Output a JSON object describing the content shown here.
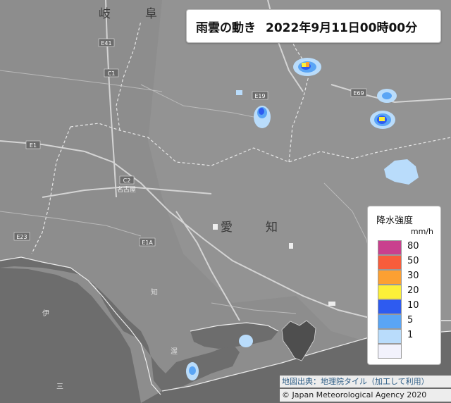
{
  "title": {
    "main": "雨雲の動き",
    "datetime": "2022年9月11日00時00分"
  },
  "legend": {
    "title": "降水強度",
    "unit": "mm/h",
    "items": [
      {
        "label": "80",
        "color": "#c9408e"
      },
      {
        "label": "50",
        "color": "#f85d3b"
      },
      {
        "label": "30",
        "color": "#fca032"
      },
      {
        "label": "20",
        "color": "#fcf039"
      },
      {
        "label": "10",
        "color": "#2e5bf0"
      },
      {
        "label": "5",
        "color": "#5aa5f5"
      },
      {
        "label": "1",
        "color": "#b9dcfb"
      },
      {
        "label": "",
        "color": "#f2f2fc"
      }
    ]
  },
  "map_labels": {
    "pref_gifu_1": "岐",
    "pref_gifu_2": "阜",
    "pref_aichi_1": "愛",
    "pref_aichi_2": "知",
    "city_nagoya": "名古屋",
    "road_e1": "E1",
    "road_c1": "C1",
    "road_c2": "C2",
    "road_e19": "E19",
    "road_e69": "E69",
    "road_e1a": "E1A",
    "road_e23": "E23",
    "road_e41": "E41",
    "place_ise": "伊",
    "place_mie": "三",
    "place_atsumi": "渥",
    "place_chita": "知"
  },
  "attribution": {
    "map_source": "地図出典：地理院タイル（加工して利用）",
    "copyright": "© Japan Meteorological Agency 2020"
  }
}
